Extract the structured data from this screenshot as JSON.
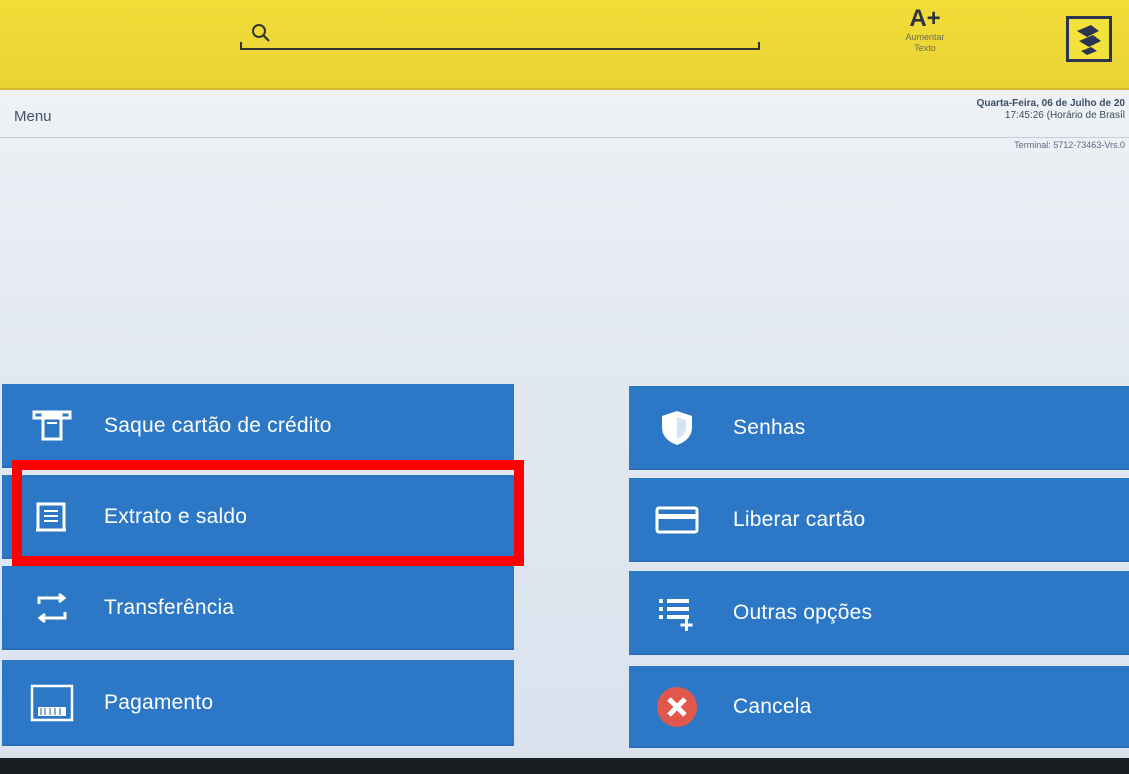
{
  "topbar": {
    "font_size_label": "A+",
    "font_size_caption": "Aumentar Texto"
  },
  "info": {
    "menu_label": "Menu",
    "date_line": "Quarta-Feira, 06 de Julho de 20",
    "time_line": "17:45:26 (Horário de Brasíl",
    "terminal_line": "Terminal: 5712-73463-Vrs.0"
  },
  "buttons": {
    "left": [
      {
        "label": "Saque cartão de crédito",
        "icon": "atm-withdraw-icon"
      },
      {
        "label": "Extrato e saldo",
        "icon": "statement-icon"
      },
      {
        "label": "Transferência",
        "icon": "transfer-icon"
      },
      {
        "label": "Pagamento",
        "icon": "barcode-payment-icon"
      }
    ],
    "right": [
      {
        "label": "Senhas",
        "icon": "shield-icon"
      },
      {
        "label": "Liberar cartão",
        "icon": "card-icon"
      },
      {
        "label": "Outras opções",
        "icon": "list-add-icon"
      },
      {
        "label": "Cancela",
        "icon": "cancel-icon"
      }
    ]
  },
  "colors": {
    "topbar_yellow": "#f1dd38",
    "button_blue": "#2d78c6",
    "highlight_red": "#ff0000",
    "cancel_red": "#e2574c"
  }
}
